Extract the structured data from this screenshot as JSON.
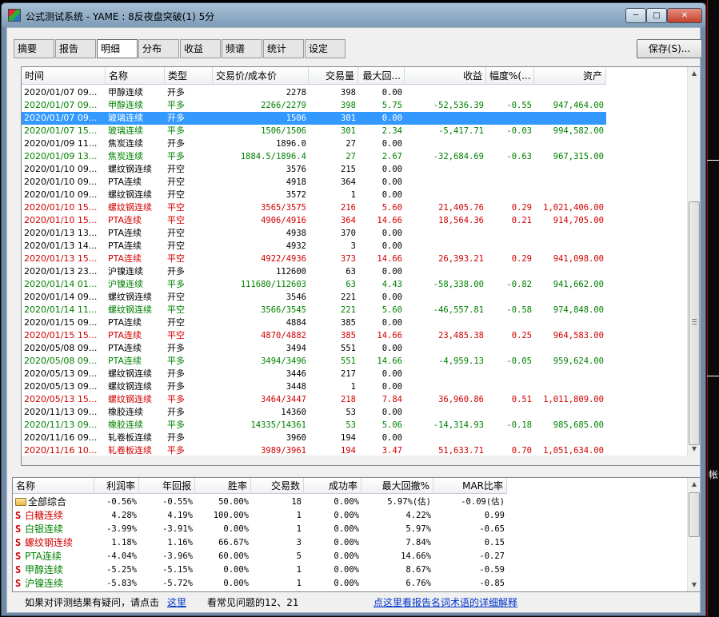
{
  "window": {
    "title": "公式测试系统 - YAME : 8反夜盘突破(1) 5分",
    "minimize_glyph": "─",
    "maximize_glyph": "□",
    "close_glyph": "✕"
  },
  "tabs": [
    {
      "label": "摘要",
      "active": false
    },
    {
      "label": "报告",
      "active": false
    },
    {
      "label": "明细",
      "active": true
    },
    {
      "label": "分布",
      "active": false
    },
    {
      "label": "收益",
      "active": false
    },
    {
      "label": "频谱",
      "active": false
    },
    {
      "label": "统计",
      "active": false
    },
    {
      "label": "设定",
      "active": false
    }
  ],
  "save_button": "保存(S)...",
  "detail_table": {
    "columns": [
      "时间",
      "名称",
      "类型",
      "交易价/成本价",
      "交易量",
      "最大回...",
      "收益",
      "幅度%(...",
      "资产"
    ],
    "rows": [
      {
        "color": "blk",
        "time": "2020/01/07 09...",
        "name": "甲醇连续",
        "type": "开多",
        "price": "2278",
        "volume": "398",
        "maxdd": "0.00",
        "profit": "",
        "amp": "",
        "asset": ""
      },
      {
        "color": "green",
        "time": "2020/01/07 09...",
        "name": "甲醇连续",
        "type": "平多",
        "price": "2266/2279",
        "volume": "398",
        "maxdd": "5.75",
        "profit": "-52,536.39",
        "amp": "-0.55",
        "asset": "947,464.00"
      },
      {
        "color": "blk",
        "selected": true,
        "time": "2020/01/07 09...",
        "name": "玻璃连续",
        "type": "开多",
        "price": "1506",
        "volume": "301",
        "maxdd": "0.00",
        "profit": "",
        "amp": "",
        "asset": ""
      },
      {
        "color": "green",
        "time": "2020/01/07 15...",
        "name": "玻璃连续",
        "type": "平多",
        "price": "1506/1506",
        "volume": "301",
        "maxdd": "2.34",
        "profit": "-5,417.71",
        "amp": "-0.03",
        "asset": "994,582.00"
      },
      {
        "color": "blk",
        "time": "2020/01/09 11...",
        "name": "焦炭连续",
        "type": "开多",
        "price": "1896.0",
        "volume": "27",
        "maxdd": "0.00",
        "profit": "",
        "amp": "",
        "asset": ""
      },
      {
        "color": "green",
        "time": "2020/01/09 13...",
        "name": "焦炭连续",
        "type": "平多",
        "price": "1884.5/1896.4",
        "volume": "27",
        "maxdd": "2.67",
        "profit": "-32,684.69",
        "amp": "-0.63",
        "asset": "967,315.00"
      },
      {
        "color": "blk",
        "time": "2020/01/10 09...",
        "name": "螺纹钢连续",
        "type": "开空",
        "price": "3576",
        "volume": "215",
        "maxdd": "0.00",
        "profit": "",
        "amp": "",
        "asset": ""
      },
      {
        "color": "blk",
        "time": "2020/01/10 09...",
        "name": "PTA连续",
        "type": "开空",
        "price": "4918",
        "volume": "364",
        "maxdd": "0.00",
        "profit": "",
        "amp": "",
        "asset": ""
      },
      {
        "color": "blk",
        "time": "2020/01/10 09...",
        "name": "螺纹钢连续",
        "type": "开空",
        "price": "3572",
        "volume": "1",
        "maxdd": "0.00",
        "profit": "",
        "amp": "",
        "asset": ""
      },
      {
        "color": "red",
        "time": "2020/01/10 15...",
        "name": "螺纹钢连续",
        "type": "平空",
        "price": "3565/3575",
        "volume": "216",
        "maxdd": "5.60",
        "profit": "21,405.76",
        "amp": "0.29",
        "asset": "1,021,406.00"
      },
      {
        "color": "red",
        "time": "2020/01/10 15...",
        "name": "PTA连续",
        "type": "平空",
        "price": "4906/4916",
        "volume": "364",
        "maxdd": "14.66",
        "profit": "18,564.36",
        "amp": "0.21",
        "asset": "914,705.00"
      },
      {
        "color": "blk",
        "time": "2020/01/13 13...",
        "name": "PTA连续",
        "type": "开空",
        "price": "4938",
        "volume": "370",
        "maxdd": "0.00",
        "profit": "",
        "amp": "",
        "asset": ""
      },
      {
        "color": "blk",
        "time": "2020/01/13 14...",
        "name": "PTA连续",
        "type": "开空",
        "price": "4932",
        "volume": "3",
        "maxdd": "0.00",
        "profit": "",
        "amp": "",
        "asset": ""
      },
      {
        "color": "red",
        "time": "2020/01/13 15...",
        "name": "PTA连续",
        "type": "平空",
        "price": "4922/4936",
        "volume": "373",
        "maxdd": "14.66",
        "profit": "26,393.21",
        "amp": "0.29",
        "asset": "941,098.00"
      },
      {
        "color": "blk",
        "time": "2020/01/13 23...",
        "name": "沪镍连续",
        "type": "开多",
        "price": "112600",
        "volume": "63",
        "maxdd": "0.00",
        "profit": "",
        "amp": "",
        "asset": ""
      },
      {
        "color": "green",
        "time": "2020/01/14 01...",
        "name": "沪镍连续",
        "type": "平多",
        "price": "111680/112603",
        "volume": "63",
        "maxdd": "4.43",
        "profit": "-58,338.00",
        "amp": "-0.82",
        "asset": "941,662.00"
      },
      {
        "color": "blk",
        "time": "2020/01/14 09...",
        "name": "螺纹钢连续",
        "type": "开空",
        "price": "3546",
        "volume": "221",
        "maxdd": "0.00",
        "profit": "",
        "amp": "",
        "asset": ""
      },
      {
        "color": "green",
        "time": "2020/01/14 11...",
        "name": "螺纹钢连续",
        "type": "平空",
        "price": "3566/3545",
        "volume": "221",
        "maxdd": "5.60",
        "profit": "-46,557.81",
        "amp": "-0.58",
        "asset": "974,848.00"
      },
      {
        "color": "blk",
        "time": "2020/01/15 09...",
        "name": "PTA连续",
        "type": "开空",
        "price": "4884",
        "volume": "385",
        "maxdd": "0.00",
        "profit": "",
        "amp": "",
        "asset": ""
      },
      {
        "color": "red",
        "time": "2020/01/15 15...",
        "name": "PTA连续",
        "type": "平空",
        "price": "4870/4882",
        "volume": "385",
        "maxdd": "14.66",
        "profit": "23,485.38",
        "amp": "0.25",
        "asset": "964,583.00"
      },
      {
        "color": "blk",
        "time": "2020/05/08 09...",
        "name": "PTA连续",
        "type": "开多",
        "price": "3494",
        "volume": "551",
        "maxdd": "0.00",
        "profit": "",
        "amp": "",
        "asset": ""
      },
      {
        "color": "green",
        "time": "2020/05/08 09...",
        "name": "PTA连续",
        "type": "平多",
        "price": "3494/3496",
        "volume": "551",
        "maxdd": "14.66",
        "profit": "-4,959.13",
        "amp": "-0.05",
        "asset": "959,624.00"
      },
      {
        "color": "blk",
        "time": "2020/05/13 09...",
        "name": "螺纹钢连续",
        "type": "开多",
        "price": "3446",
        "volume": "217",
        "maxdd": "0.00",
        "profit": "",
        "amp": "",
        "asset": ""
      },
      {
        "color": "blk",
        "time": "2020/05/13 09...",
        "name": "螺纹钢连续",
        "type": "开多",
        "price": "3448",
        "volume": "1",
        "maxdd": "0.00",
        "profit": "",
        "amp": "",
        "asset": ""
      },
      {
        "color": "red",
        "time": "2020/05/13 15...",
        "name": "螺纹钢连续",
        "type": "平多",
        "price": "3464/3447",
        "volume": "218",
        "maxdd": "7.84",
        "profit": "36,960.86",
        "amp": "0.51",
        "asset": "1,011,809.00"
      },
      {
        "color": "blk",
        "time": "2020/11/13 09...",
        "name": "橡胶连续",
        "type": "开多",
        "price": "14360",
        "volume": "53",
        "maxdd": "0.00",
        "profit": "",
        "amp": "",
        "asset": ""
      },
      {
        "color": "green",
        "time": "2020/11/13 09...",
        "name": "橡胶连续",
        "type": "平多",
        "price": "14335/14361",
        "volume": "53",
        "maxdd": "5.06",
        "profit": "-14,314.93",
        "amp": "-0.18",
        "asset": "985,685.00"
      },
      {
        "color": "blk",
        "time": "2020/11/16 09...",
        "name": "轧卷板连续",
        "type": "开多",
        "price": "3960",
        "volume": "194",
        "maxdd": "0.00",
        "profit": "",
        "amp": "",
        "asset": ""
      },
      {
        "color": "red",
        "time": "2020/11/16 10...",
        "name": "轧卷板连续",
        "type": "平多",
        "price": "3989/3961",
        "volume": "194",
        "maxdd": "3.47",
        "profit": "51,633.71",
        "amp": "0.70",
        "asset": "1,051,634.00"
      }
    ]
  },
  "summary_table": {
    "columns": [
      "名称",
      "利润率",
      "年回报",
      "胜率",
      "交易数",
      "成功率",
      "最大回撤%",
      "MAR比率"
    ],
    "rows": [
      {
        "icon": "folder",
        "color": "blk",
        "name": "全部综合",
        "profit_rate": "-0.56%",
        "annual": "-0.55%",
        "win": "50.00%",
        "trades": "18",
        "success": "0.00%",
        "maxdd": "5.97%(估)",
        "mar": "-0.09(估)"
      },
      {
        "icon": "S",
        "color": "red",
        "name": "白糖连续",
        "profit_rate": "4.28%",
        "annual": "4.19%",
        "win": "100.00%",
        "trades": "1",
        "success": "0.00%",
        "maxdd": "4.22%",
        "mar": "0.99"
      },
      {
        "icon": "S",
        "color": "green",
        "name": "白银连续",
        "profit_rate": "-3.99%",
        "annual": "-3.91%",
        "win": "0.00%",
        "trades": "1",
        "success": "0.00%",
        "maxdd": "5.97%",
        "mar": "-0.65"
      },
      {
        "icon": "S",
        "color": "red",
        "name": "螺纹钢连续",
        "profit_rate": "1.18%",
        "annual": "1.16%",
        "win": "66.67%",
        "trades": "3",
        "success": "0.00%",
        "maxdd": "7.84%",
        "mar": "0.15"
      },
      {
        "icon": "S",
        "color": "green",
        "name": "PTA连续",
        "profit_rate": "-4.04%",
        "annual": "-3.96%",
        "win": "60.00%",
        "trades": "5",
        "success": "0.00%",
        "maxdd": "14.66%",
        "mar": "-0.27"
      },
      {
        "icon": "S",
        "color": "green",
        "name": "甲醇连续",
        "profit_rate": "-5.25%",
        "annual": "-5.15%",
        "win": "0.00%",
        "trades": "1",
        "success": "0.00%",
        "maxdd": "8.67%",
        "mar": "-0.59"
      },
      {
        "icon": "S",
        "color": "green",
        "name": "沪镍连续",
        "profit_rate": "-5.83%",
        "annual": "-5.72%",
        "win": "0.00%",
        "trades": "1",
        "success": "0.00%",
        "maxdd": "6.76%",
        "mar": "-0.85"
      }
    ]
  },
  "footer": {
    "question_text": "如果对评测结果有疑问，请点击",
    "here_link": "这里",
    "faq_text": "看常见问题的12、21",
    "glossary_link": "点这里看报告名词术语的详细解释"
  },
  "background_edge_text": "帐"
}
